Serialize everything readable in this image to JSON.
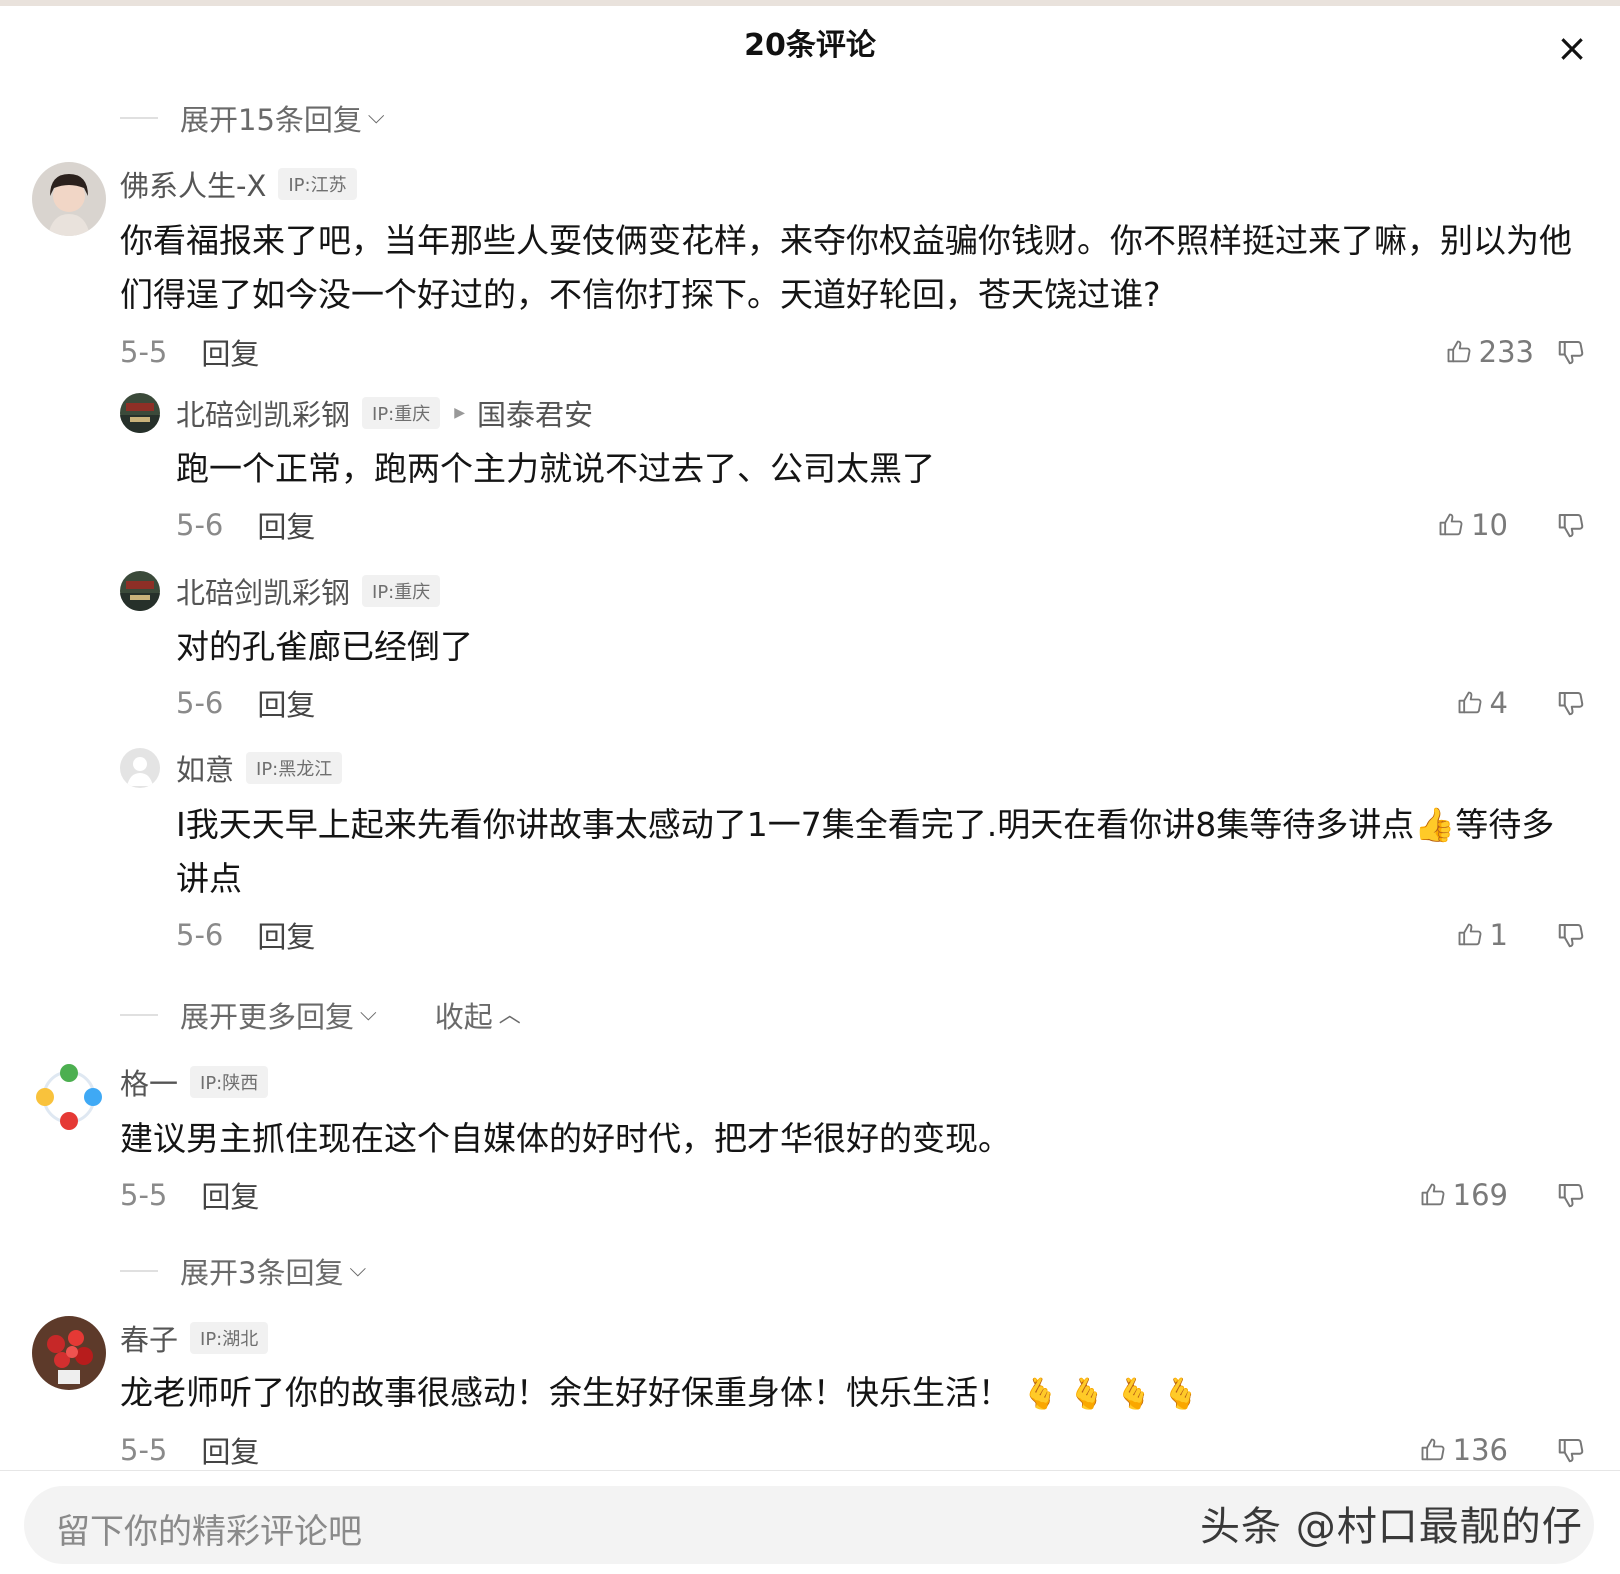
{
  "header": {
    "title": "20条评论",
    "close_glyph": "×"
  },
  "expand_top": {
    "label": "展开15条回复"
  },
  "comments": [
    {
      "user": "佛系人生-X",
      "ip": "IP:江苏",
      "text": "你看福报来了吧，当年那些人耍伎俩变花样，来夺你权益骗你钱财。你不照样挺过来了嘛，别以为他们得逞了如今没一个好过的，不信你打探下。天道好轮回，苍天饶过谁?",
      "date": "5-5",
      "reply": "回复",
      "likes": "233"
    },
    {
      "user": "格一",
      "ip": "IP:陕西",
      "text": "建议男主抓住现在这个自媒体的好时代，把才华很好的变现。",
      "date": "5-5",
      "reply": "回复",
      "likes": "169"
    },
    {
      "user": "春子",
      "ip": "IP:湖北",
      "text": "龙老师听了你的故事很感动！余生好好保重身体！快乐生活！",
      "emojis": "🫰 🫰 🫰 🫰",
      "date": "5-5",
      "reply": "回复",
      "likes": "136"
    }
  ],
  "replies": [
    {
      "user": "北碚剑凯彩钢",
      "ip": "IP:重庆",
      "reply_to": "国泰君安",
      "text": "跑一个正常，跑两个主力就说不过去了、公司太黑了",
      "date": "5-6",
      "reply": "回复",
      "likes": "10"
    },
    {
      "user": "北碚剑凯彩钢",
      "ip": "IP:重庆",
      "text": "对的孔雀廊已经倒了",
      "date": "5-6",
      "reply": "回复",
      "likes": "4"
    },
    {
      "user": "如意",
      "ip": "IP:黑龙江",
      "text": "I我天天早上起来先看你讲故事太感动了1一7集全看完了.明天在看你讲8集等待多讲点👍等待多讲点",
      "date": "5-6",
      "reply": "回复",
      "likes": "1"
    }
  ],
  "expand_more": {
    "label": "展开更多回复",
    "collapse_label": "收起"
  },
  "expand_second": {
    "label": "展开3条回复"
  },
  "input": {
    "placeholder": "留下你的精彩评论吧"
  },
  "watermark": "头条 @村口最靓的仔",
  "colors": {
    "text": "#141414",
    "meta": "#8a8a8a",
    "username": "#555555",
    "input_bg": "#f3f3f3"
  }
}
